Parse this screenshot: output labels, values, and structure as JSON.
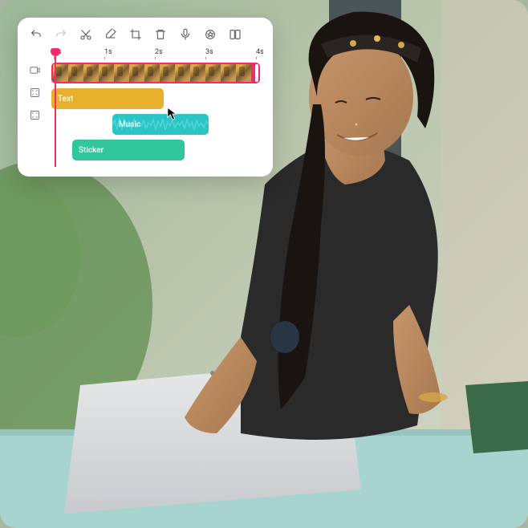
{
  "ruler": {
    "ticks": [
      "0s",
      "1s",
      "2s",
      "3s",
      "4s"
    ],
    "playhead_position": 0
  },
  "tracks": {
    "video": {
      "label": ""
    },
    "text": {
      "label": "Text"
    },
    "music": {
      "label": "Music"
    },
    "sticker": {
      "label": "Sticker"
    }
  },
  "colors": {
    "video_track": "#f32b6a",
    "text_track": "#e6b02c",
    "music_track": "#2bc5c5",
    "sticker_track": "#2fc79b",
    "playhead": "#f32b6a"
  }
}
